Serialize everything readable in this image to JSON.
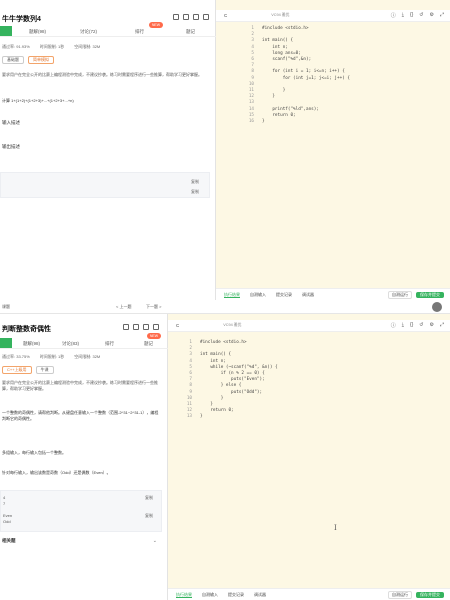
{
  "top": {
    "title": "牛牛学数列4",
    "tabs": [
      "",
      "题解(98)",
      "讨论(72)",
      "排行",
      "题记"
    ],
    "new_badge": "NEW",
    "meta": [
      "通过率: 91.93%",
      "时间限制: 1秒",
      "空间限制: 32M"
    ],
    "tags": [
      "基础题",
      "简单模拟"
    ],
    "desc1": "要求用户在完全公开的比赛上编程测验中完成，不建议抄袭。练习时需要程序进行一些推算，帮助学习更好掌握。",
    "desc2": "计算 1+(1+2)+(1+2+3)+...+(1+2+3+...+n)",
    "input_label": "输入描述",
    "output_label": "输出描述",
    "copy": "复制",
    "copy2": "复制",
    "editor": {
      "lang": "C",
      "std": "VC94 雅优",
      "code": [
        "#include <stdio.h>",
        "",
        "int main() {",
        "    int n;",
        "    long ans=0;",
        "    scanf(\"%d\",&n);",
        "",
        "    for (int i = 1; i<=n; i++) {",
        "        for (int j=1; j<=i; j++) {",
        "",
        "        }",
        "    }",
        "",
        "    printf(\"%ld\",ans);",
        "    return 0;",
        "}"
      ],
      "bottom": [
        "执行结果",
        "自测输入",
        "提交记录",
        "调试器"
      ],
      "run": "自测运行",
      "save": "保存并提交"
    }
  },
  "bottom": {
    "nav_left": "课题",
    "prev": "< 上一题",
    "next": "下一题 >",
    "title": "判断整数奇偶性",
    "tabs": [
      "",
      "题解(98)",
      "讨论(83)",
      "排行",
      "题记"
    ],
    "new_badge": "NEW",
    "meta": [
      "通过率: 33.75%",
      "时间限制: 1秒",
      "空间限制: 32M"
    ],
    "tags": [
      "C++上级用",
      "牛课"
    ],
    "desc1": "要求用户在完全公开的比赛上编程测验中完成，不建议抄袭。练习时需要程序进行一些推算，帮助学习更好掌握。",
    "desc2": "一个整数的奇偶性，请帮他判断。从键盘任意输入一个整数（范围-2^31~2^31-1），编程判断它的奇偶性。",
    "input_desc": "多组输入，每行输入包括一个整数。",
    "output_desc": "针对每行输入，输出该数是奇数（Odd）还是偶数（Even）。",
    "sample_in": "4",
    "sample_in2": "7",
    "sample_out": "Even",
    "sample_out2": "Odd",
    "copy": "复制",
    "related": "相关题",
    "editor": {
      "lang": "C",
      "std": "VC94 雅优",
      "code": [
        "#include <stdio.h>",
        "",
        "int main() {",
        "    int n;",
        "    while (~scanf(\"%d\", &n)) {",
        "        if (n % 2 == 0) {",
        "            puts(\"Even\");",
        "        } else {",
        "            puts(\"Odd\");",
        "        }",
        "    }",
        "    return 0;",
        "}"
      ],
      "bottom": [
        "执行结果",
        "自测输入",
        "提交记录",
        "调试器"
      ],
      "run": "自测运行",
      "save": "保存并提交"
    }
  }
}
